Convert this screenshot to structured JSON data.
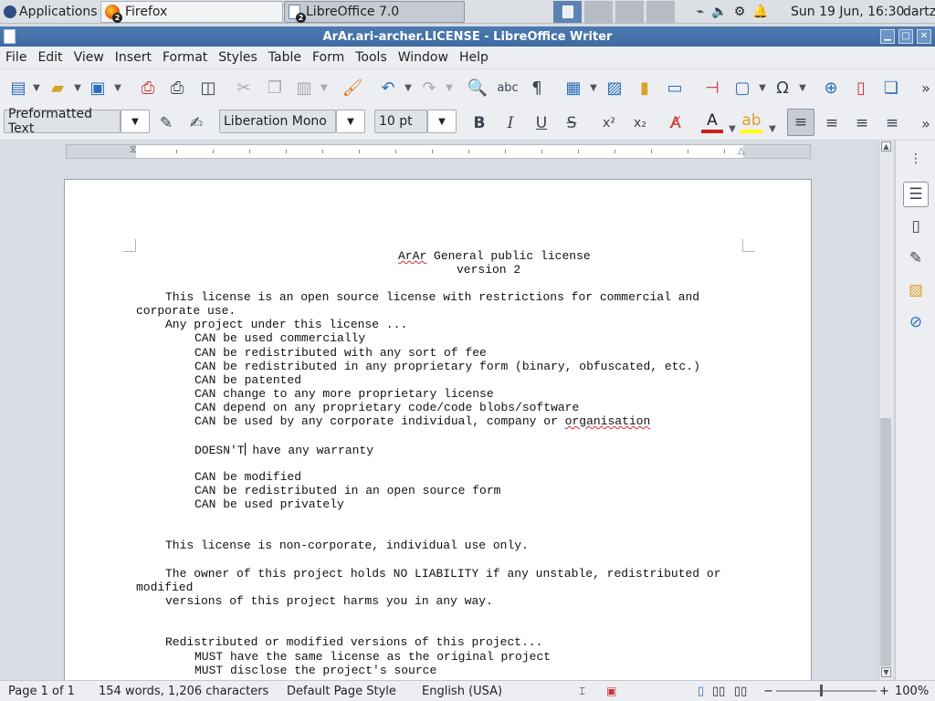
{
  "panel": {
    "applications_label": "Applications",
    "tasks": [
      {
        "label": "Firefox",
        "badge": "2"
      },
      {
        "label": "LibreOffice 7.0",
        "badge": "2"
      }
    ],
    "clock": "Sun 19 Jun, 16:30",
    "user": "dartz"
  },
  "window": {
    "title": "ArAr.ari-archer.LICENSE - LibreOffice Writer"
  },
  "menubar": [
    "File",
    "Edit",
    "View",
    "Insert",
    "Format",
    "Styles",
    "Table",
    "Form",
    "Tools",
    "Window",
    "Help"
  ],
  "format_toolbar": {
    "paragraph_style": "Preformatted Text",
    "font_name": "Liberation Mono",
    "font_size": "10 pt"
  },
  "document": {
    "lines": [
      "ArAr General public license",
      "version 2",
      "This license is an open source license with restrictions for commercial and",
      "corporate use.",
      "Any project under this license ...",
      "CAN be used commercially",
      "CAN be redistributed with any sort of fee",
      "CAN be redistributed in any proprietary form (binary, obfuscated, etc.)",
      "CAN be patented",
      "CAN change to any more proprietary license",
      "CAN depend on any proprietary code/code blobs/software",
      "CAN be used by any corporate individual, company or organisation",
      "DOESN'T have any warranty",
      "CAN be modified",
      "CAN be redistributed in an open source form",
      "CAN be used privately",
      "This license is non-corporate, individual use only.",
      "The owner of this project holds NO LIABILITY if any unstable, redistributed or",
      "modified",
      "versions of this project harms you in any way.",
      "Redistributed or modified versions of this project...",
      "MUST have the same license as the original project",
      "MUST disclose the project's source"
    ]
  },
  "statusbar": {
    "page": "Page 1 of 1",
    "word_count": "154 words, 1,206 characters",
    "page_style": "Default Page Style",
    "language": "English (USA)",
    "zoom": "100%"
  },
  "colors": {
    "titlebar": "#4574aa",
    "accent": "#5d83b5",
    "font_color": "#c9211e",
    "highlight": "#ffff00"
  }
}
